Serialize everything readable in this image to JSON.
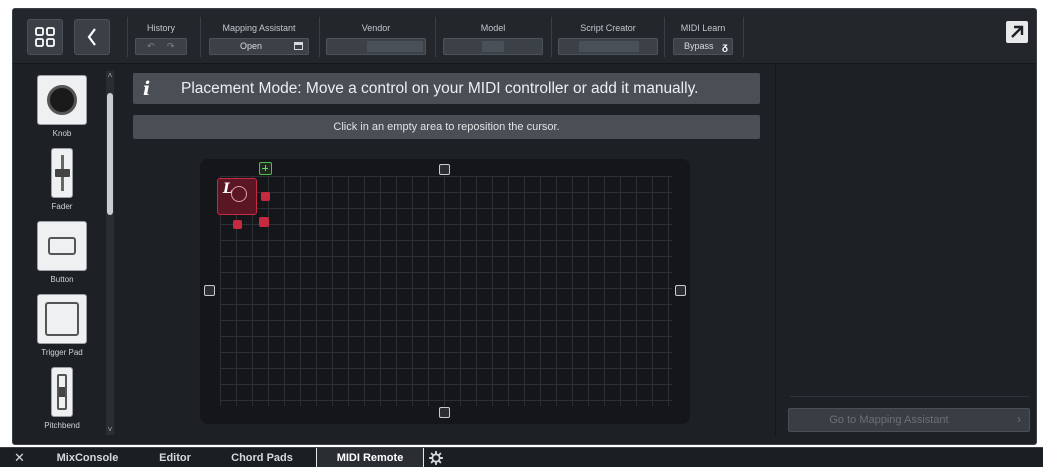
{
  "toolbar": {
    "history": {
      "label": "History",
      "undo_icon": "undo-icon",
      "redo_icon": "redo-icon"
    },
    "mapping_assistant": {
      "label": "Mapping Assistant",
      "button": "Open",
      "icon": "window-icon"
    },
    "vendor": {
      "label": "Vendor"
    },
    "model": {
      "label": "Model"
    },
    "script_creator": {
      "label": "Script Creator"
    },
    "midi_learn": {
      "label": "MIDI Learn",
      "button": "Bypass",
      "icon": "learn-icon"
    }
  },
  "palette": {
    "items": [
      {
        "label": "Knob"
      },
      {
        "label": "Fader"
      },
      {
        "label": "Button"
      },
      {
        "label": "Trigger Pad"
      },
      {
        "label": "Pitchbend"
      }
    ]
  },
  "info": {
    "icon": "i",
    "message": "Placement Mode: Move a control on your MIDI controller or add it manually.",
    "hint": "Click in an empty area to reposition the cursor."
  },
  "canvas": {
    "control_label": "L"
  },
  "right_panel": {
    "goto_label": "Go to Mapping Assistant",
    "goto_arrow": "›"
  },
  "tabs": {
    "close": "✕",
    "items": [
      "MixConsole",
      "Editor",
      "Chord Pads",
      "MIDI Remote"
    ],
    "active": "MIDI Remote"
  },
  "colors": {
    "accent_control": "#c92a43",
    "add_button": "#4fbf4f",
    "panel_background": "#1d2126"
  }
}
